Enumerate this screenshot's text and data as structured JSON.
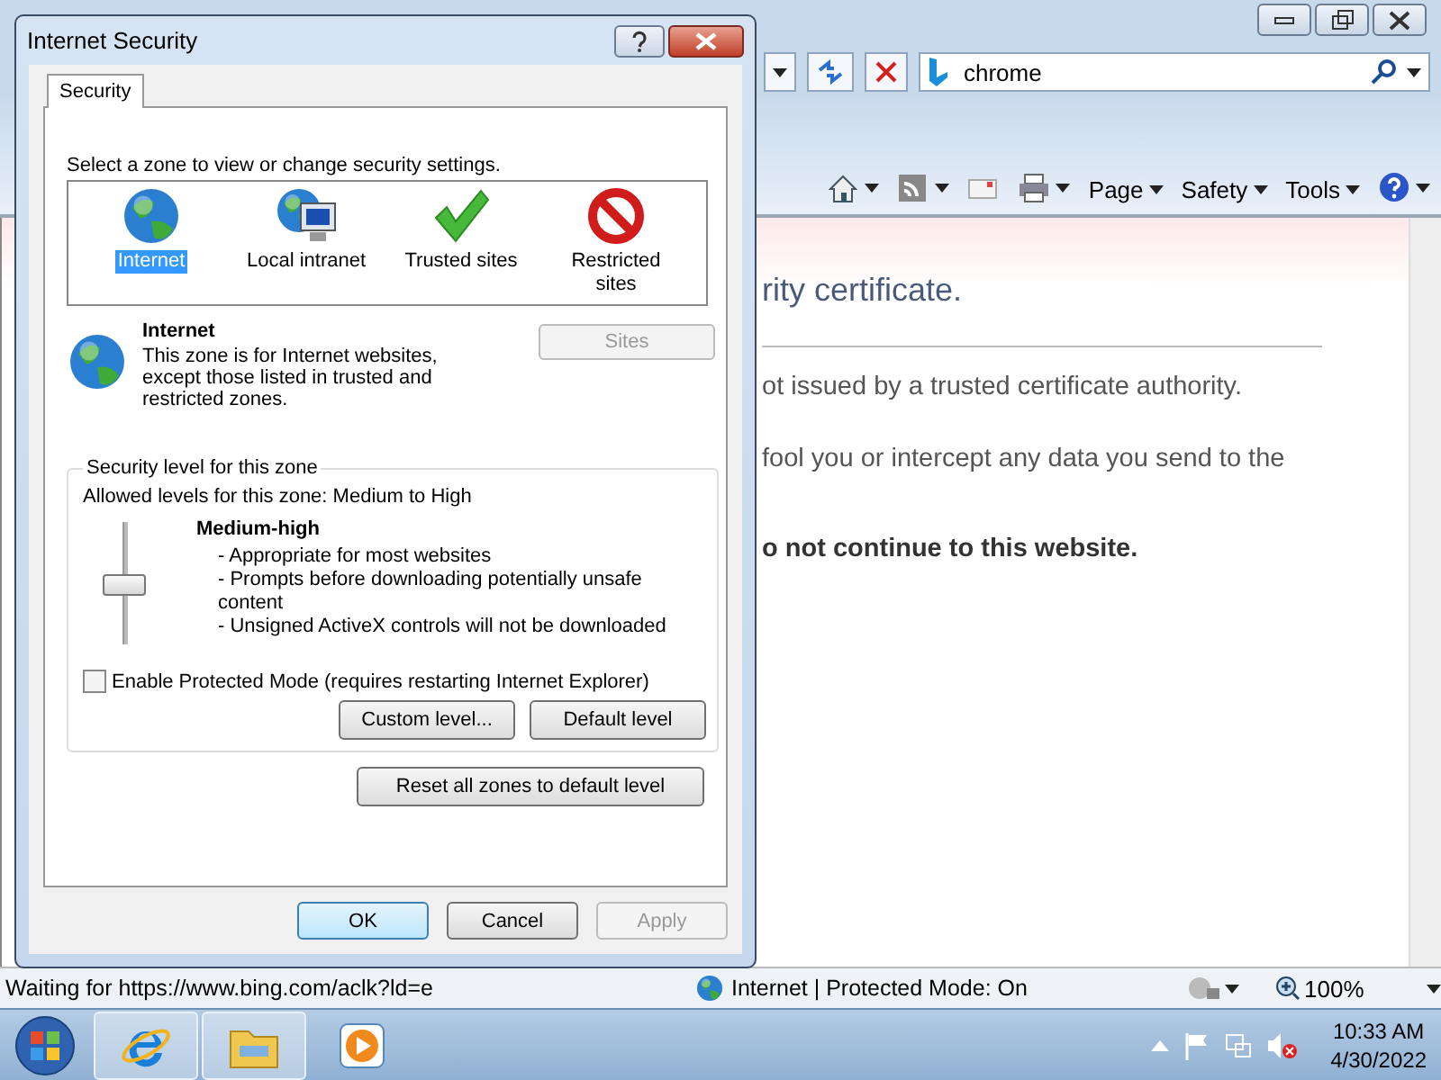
{
  "browser": {
    "search": {
      "value": "chrome"
    },
    "commands": [
      {
        "label": "Page"
      },
      {
        "label": "Safety"
      },
      {
        "label": "Tools"
      }
    ],
    "content": [
      {
        "kind": "heading",
        "text": "rity certificate."
      },
      {
        "kind": "rule"
      },
      {
        "kind": "para",
        "text": "ot issued by a trusted certificate authority."
      },
      {
        "kind": "para",
        "text": "fool you or intercept any data you send to the"
      },
      {
        "kind": "strong",
        "text": "o not continue to this website."
      }
    ],
    "status_bar": {
      "text": "Waiting for https://www.bing.com/aclk?ld=e",
      "zone": "Internet | Protected Mode: On",
      "zoom": "100%"
    }
  },
  "dialog": {
    "title": "Internet Security",
    "tabs": [
      {
        "label": "Security",
        "selected": true
      }
    ],
    "zone_prompt": "Select a zone to view or change security settings.",
    "zones": [
      {
        "label": "Internet",
        "kind": "internet",
        "selected": true
      },
      {
        "label": "Local intranet",
        "kind": "intranet",
        "selected": false
      },
      {
        "label": "Trusted sites",
        "kind": "trusted",
        "selected": false
      },
      {
        "label": "Restricted sites",
        "kind": "restricted",
        "selected": false
      }
    ],
    "zone_info": {
      "name": "Internet",
      "description": "This zone is for Internet websites, except those listed in trusted and restricted zones.",
      "sites_button": {
        "label": "Sites",
        "disabled": true
      }
    },
    "security_level": {
      "title": "Security level for this zone",
      "allowed": "Allowed levels for this zone: Medium to High",
      "level": 0.5,
      "level_name": "Medium-high",
      "bullets": [
        "- Appropriate for most websites",
        "- Prompts before downloading potentially unsafe content",
        "- Unsigned ActiveX controls will not be downloaded"
      ]
    },
    "protected_mode": {
      "label": "Enable Protected Mode (requires restarting Internet Explorer)",
      "checked": false
    },
    "level_buttons": [
      {
        "label": "Custom level...",
        "disabled": false
      },
      {
        "label": "Default level",
        "disabled": false
      }
    ],
    "reset_button": {
      "label": "Reset all zones to default level",
      "disabled": false
    },
    "buttons": [
      {
        "label": "OK",
        "default": true,
        "disabled": false
      },
      {
        "label": "Cancel",
        "default": false,
        "disabled": false
      },
      {
        "label": "Apply",
        "default": false,
        "disabled": true
      }
    ]
  },
  "taskbar": {
    "apps": [
      {
        "kind": "ie",
        "running": true
      },
      {
        "kind": "explorer",
        "running": true
      },
      {
        "kind": "media",
        "running": false
      }
    ],
    "time": "10:33 AM",
    "date": "4/30/2022"
  }
}
